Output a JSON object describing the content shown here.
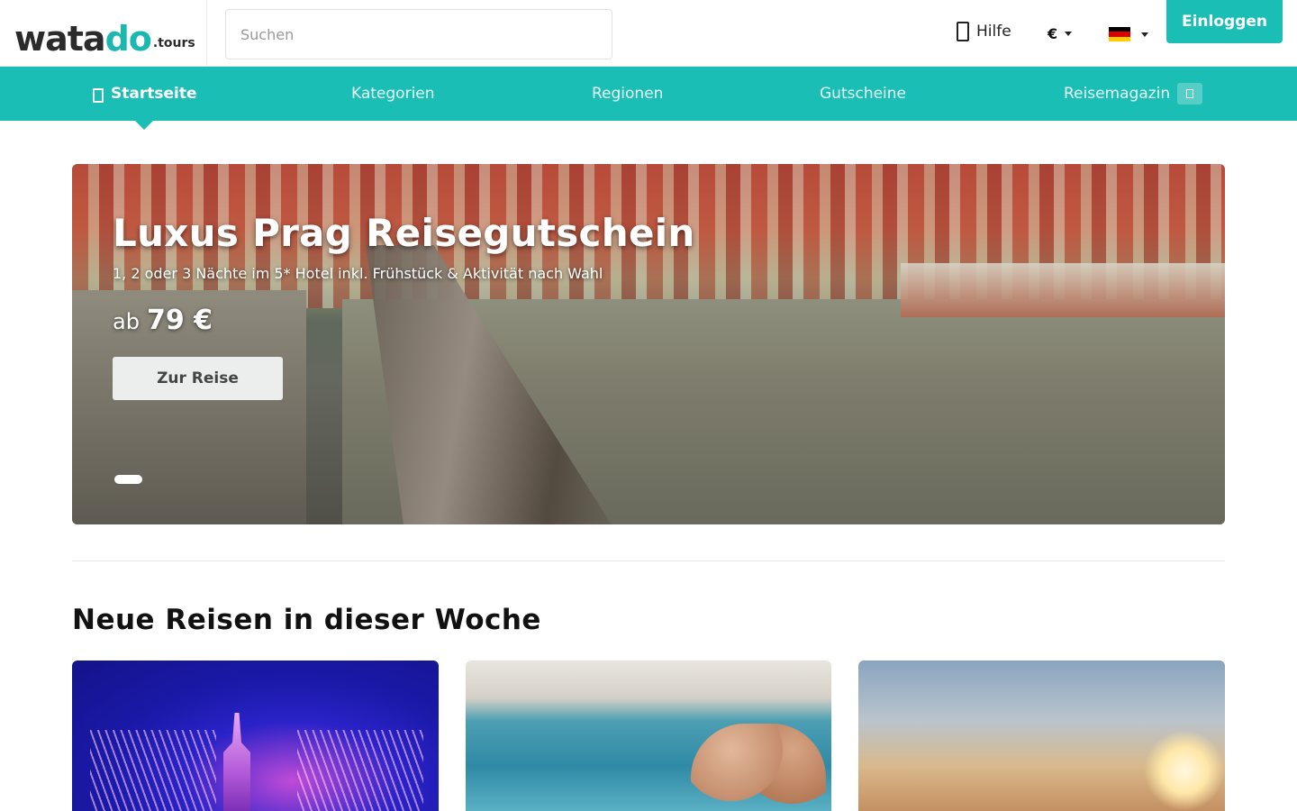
{
  "header": {
    "logo_main": "wata",
    "logo_do": "do",
    "logo_suffix": ".tours",
    "search_placeholder": "Suchen",
    "help_label": "Hilfe",
    "currency": "€",
    "language_flag": "de-flag",
    "login_label": "Einloggen"
  },
  "nav": {
    "items": [
      {
        "label": "Startseite",
        "active": true,
        "icon": "home-icon"
      },
      {
        "label": "Kategorien"
      },
      {
        "label": "Regionen"
      },
      {
        "label": "Gutscheine"
      },
      {
        "label": "Reisemagazin",
        "icon": "magazine-icon"
      }
    ]
  },
  "hero": {
    "title": "Luxus Prag Reisegutschein",
    "subtitle": "1, 2 oder 3 Nächte im 5* Hotel inkl. Frühstück & Aktivität nach Wahl",
    "price_prefix": "ab",
    "price_amount": "79 €",
    "button_label": "Zur Reise",
    "active_slide": 1
  },
  "section": {
    "title": "Neue Reisen in dieser Woche",
    "cards": [
      {
        "image": "castle-fireworks-image"
      },
      {
        "image": "couple-whirlpool-image"
      },
      {
        "image": "sunset-sky-image"
      }
    ]
  },
  "colors": {
    "accent": "#1bbeb4",
    "text": "#111111"
  }
}
